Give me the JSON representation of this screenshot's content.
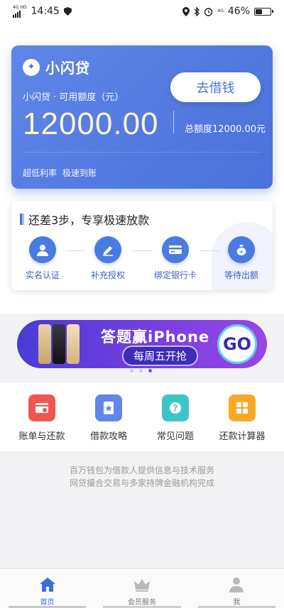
{
  "status_bar": {
    "network": "4G HD",
    "time": "14:45",
    "network_right": "4G",
    "battery": "46%",
    "battery_level": 0.46
  },
  "loan_card": {
    "brand_name": "小闪贷",
    "available_label": "小闪贷 · 可用额度（元）",
    "amount": "12000.00",
    "total_label": "总额度12000.00元",
    "borrow_button": "去借钱",
    "features": [
      "超低利率",
      "极速到账"
    ]
  },
  "steps": {
    "title": "还差3步，专享极速放款",
    "items": [
      {
        "label": "实名认证",
        "icon": "user-icon"
      },
      {
        "label": "补充授权",
        "icon": "pen-icon"
      },
      {
        "label": "绑定银行卡",
        "icon": "card-icon"
      },
      {
        "label": "等待出额",
        "icon": "money-bag-icon"
      }
    ]
  },
  "banner": {
    "title": "答题赢iPhone",
    "subtitle": "每周五开抢",
    "go": "GO"
  },
  "services": [
    {
      "label": "账单与还款",
      "icon": "bill-icon",
      "color": "#f0564f"
    },
    {
      "label": "借款攻略",
      "icon": "guide-icon",
      "color": "#5f86e8"
    },
    {
      "label": "常见问题",
      "icon": "question-icon",
      "color": "#3ec3c9"
    },
    {
      "label": "还款计算器",
      "icon": "calculator-icon",
      "color": "#f9a825"
    }
  ],
  "disclaimer": {
    "line1": "百万钱包为借款人提供信息与技术服务",
    "line2": "网贷撮合交易与多家持牌金融机构完成"
  },
  "tabbar": [
    {
      "label": "首页",
      "icon": "home-icon",
      "active": true
    },
    {
      "label": "会员服务",
      "icon": "crown-icon",
      "active": false
    },
    {
      "label": "我",
      "icon": "profile-icon",
      "active": false
    }
  ]
}
